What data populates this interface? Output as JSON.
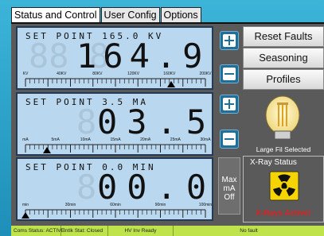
{
  "tabs": [
    "Status and Control",
    "User Config",
    "Options"
  ],
  "active_tab": 0,
  "kv_display": {
    "setpoint_title": "SET POINT 165.0 KV",
    "ghost": "88 8",
    "value": "164.9",
    "scale_labels": [
      "KV",
      "40KV",
      "80KV",
      "120KV",
      "160KV",
      "200KV"
    ],
    "marker_fraction": 0.81
  },
  "ma_display": {
    "setpoint_title": "SET POINT 3.5 MA",
    "ghost": "8",
    "value": "03.5",
    "scale_labels": [
      "mA",
      "5mA",
      "10mA",
      "15mA",
      "20mA",
      "25mA",
      "30mA"
    ],
    "marker_fraction": 0.12
  },
  "time_display": {
    "setpoint_title": "SET POINT 0.0 MIN",
    "ghost": "8",
    "value": "00.0",
    "scale_labels": [
      "min",
      "30min",
      "60min",
      "90min",
      "100min"
    ],
    "marker_fraction": 0.0
  },
  "buttons": {
    "reset_faults": "Reset Faults",
    "seasoning": "Seasoning",
    "profiles": "Profiles",
    "max_ma": "Max\nmA\nOff"
  },
  "filament": {
    "label": "Large Fil Selected"
  },
  "xray": {
    "title": "X-Ray Status",
    "state": "X-Rays Active!"
  },
  "statusbar": [
    "Coms Status: ACTIVE",
    "Intlk Stat: Closed",
    "HV Inv Ready",
    "No fault"
  ],
  "colors": {
    "accent": "#2fa3c8",
    "lcd": "#b9d7ee",
    "status_bar": "#bfe34a",
    "alert": "#e02020"
  }
}
